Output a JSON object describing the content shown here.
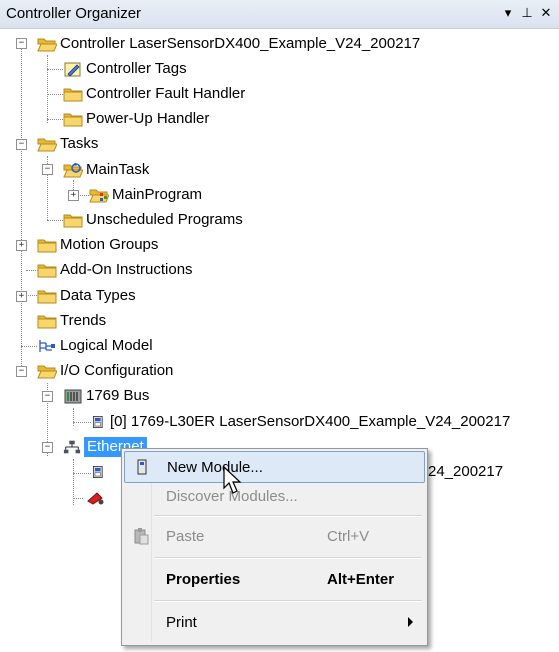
{
  "panel": {
    "title": "Controller Organizer",
    "buttons": [
      "▾",
      "⊥",
      "✕"
    ]
  },
  "tree": {
    "controller": "Controller LaserSensorDX400_Example_V24_200217",
    "controller_tags": "Controller Tags",
    "controller_fault_handler": "Controller Fault Handler",
    "power_up_handler": "Power-Up Handler",
    "tasks": "Tasks",
    "main_task": "MainTask",
    "main_program": "MainProgram",
    "unscheduled_programs": "Unscheduled Programs",
    "motion_groups": "Motion Groups",
    "add_on_instructions": "Add-On Instructions",
    "data_types": "Data Types",
    "trends": "Trends",
    "logical_model": "Logical Model",
    "io_configuration": "I/O Configuration",
    "bus_1769": "1769 Bus",
    "bus_module": "[0] 1769-L30ER LaserSensorDX400_Example_V24_200217",
    "ethernet": "Ethernet",
    "ethernet_module_suffix": "24_200217"
  },
  "context_menu": {
    "items": [
      {
        "label": "New Module...",
        "shortcut": "",
        "state": "highlighted"
      },
      {
        "label": "Discover Modules...",
        "shortcut": "",
        "state": "disabled"
      },
      {
        "label": "Paste",
        "shortcut": "Ctrl+V",
        "state": "disabled"
      },
      {
        "label": "Properties",
        "shortcut": "Alt+Enter",
        "state": "bold"
      },
      {
        "label": "Print",
        "shortcut": "",
        "state": "submenu"
      }
    ]
  },
  "colors": {
    "selection": "#3399ff",
    "folder": "#f2cf5b",
    "menu_highlight": "#dde9f7"
  }
}
